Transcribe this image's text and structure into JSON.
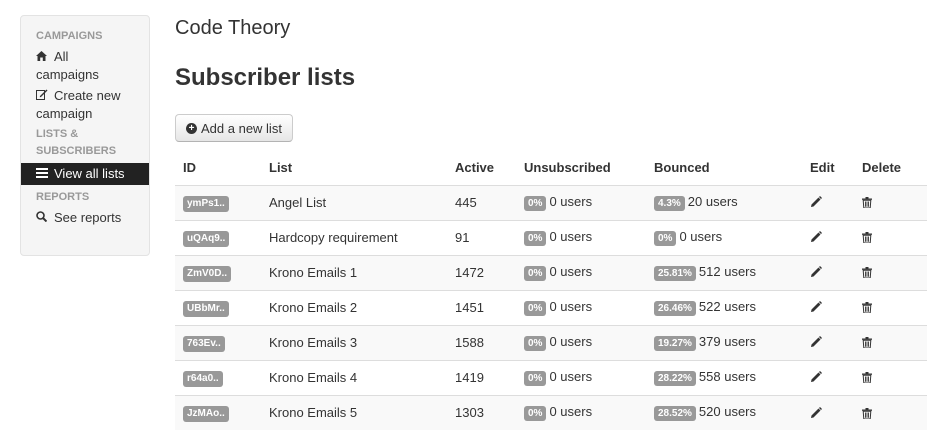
{
  "sidebar": {
    "campaigns_header": "CAMPAIGNS",
    "all_campaigns": "All campaigns",
    "create_campaign": "Create new campaign",
    "lists_header": "LISTS & SUBSCRIBERS",
    "view_all_lists": "View all lists",
    "reports_header": "REPORTS",
    "see_reports": "See reports"
  },
  "brand": "Code Theory",
  "page_title": "Subscriber lists",
  "add_button_label": "Add a new list",
  "table": {
    "headers": {
      "id": "ID",
      "list": "List",
      "active": "Active",
      "unsubscribed": "Unsubscribed",
      "bounced": "Bounced",
      "edit": "Edit",
      "delete": "Delete"
    },
    "rows": [
      {
        "id": "ymPs1..",
        "list": "Angel List",
        "active": "445",
        "unsub_pct": "0%",
        "unsub_users": "0 users",
        "bounce_pct": "4.3%",
        "bounce_users": "20 users"
      },
      {
        "id": "uQAq9..",
        "list": "Hardcopy requirement",
        "active": "91",
        "unsub_pct": "0%",
        "unsub_users": "0 users",
        "bounce_pct": "0%",
        "bounce_users": "0 users"
      },
      {
        "id": "ZmV0D..",
        "list": "Krono Emails 1",
        "active": "1472",
        "unsub_pct": "0%",
        "unsub_users": "0 users",
        "bounce_pct": "25.81%",
        "bounce_users": "512 users"
      },
      {
        "id": "UBbMr..",
        "list": "Krono Emails 2",
        "active": "1451",
        "unsub_pct": "0%",
        "unsub_users": "0 users",
        "bounce_pct": "26.46%",
        "bounce_users": "522 users"
      },
      {
        "id": "763Ev..",
        "list": "Krono Emails 3",
        "active": "1588",
        "unsub_pct": "0%",
        "unsub_users": "0 users",
        "bounce_pct": "19.27%",
        "bounce_users": "379 users"
      },
      {
        "id": "r64a0..",
        "list": "Krono Emails 4",
        "active": "1419",
        "unsub_pct": "0%",
        "unsub_users": "0 users",
        "bounce_pct": "28.22%",
        "bounce_users": "558 users"
      },
      {
        "id": "JzMAo..",
        "list": "Krono Emails 5",
        "active": "1303",
        "unsub_pct": "0%",
        "unsub_users": "0 users",
        "bounce_pct": "28.52%",
        "bounce_users": "520 users"
      }
    ]
  },
  "icons": {
    "home": "home-icon",
    "edit": "edit-icon",
    "list": "list-icon",
    "search": "search-icon",
    "plus": "plus-circle-icon",
    "pencil": "pencil-icon",
    "trash": "trash-icon"
  },
  "colors": {
    "active_nav_bg": "#222222",
    "label_bg": "#999999",
    "stripe_bg": "#f9f9f9"
  }
}
